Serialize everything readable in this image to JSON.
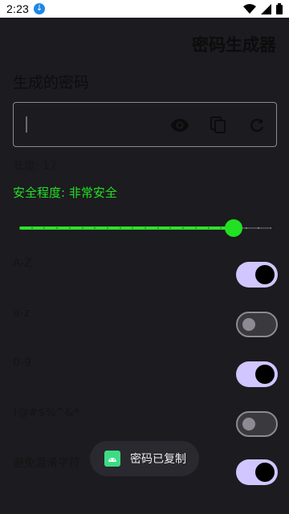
{
  "status_bar": {
    "time": "2:23",
    "download_icon": "download-arrow-icon",
    "icons": [
      "wifi-icon",
      "signal-icon",
      "battery-icon"
    ]
  },
  "app": {
    "title": "密码生成器",
    "section_title": "生成的密码"
  },
  "password_field": {
    "value": "",
    "actions": [
      {
        "name": "visibility-icon"
      },
      {
        "name": "copy-icon"
      },
      {
        "name": "refresh-icon"
      }
    ]
  },
  "length": {
    "label": "长度: 17",
    "value": 17,
    "fraction": 0.85
  },
  "safety": {
    "label": "安全程度: 非常安全",
    "color": "#22e024"
  },
  "options": [
    {
      "label": "A-Z",
      "on": true
    },
    {
      "label": "a-z",
      "on": false
    },
    {
      "label": "0-9",
      "on": true
    },
    {
      "label": "!@#$%^&*",
      "on": false
    },
    {
      "label": "避免混淆字符",
      "on": true
    }
  ],
  "toast": {
    "text": "密码已复制",
    "icon": "android-icon"
  },
  "colors": {
    "background": "#1c1b1f",
    "accent_green": "#22e022",
    "switch_on": "#d1c6ff"
  }
}
